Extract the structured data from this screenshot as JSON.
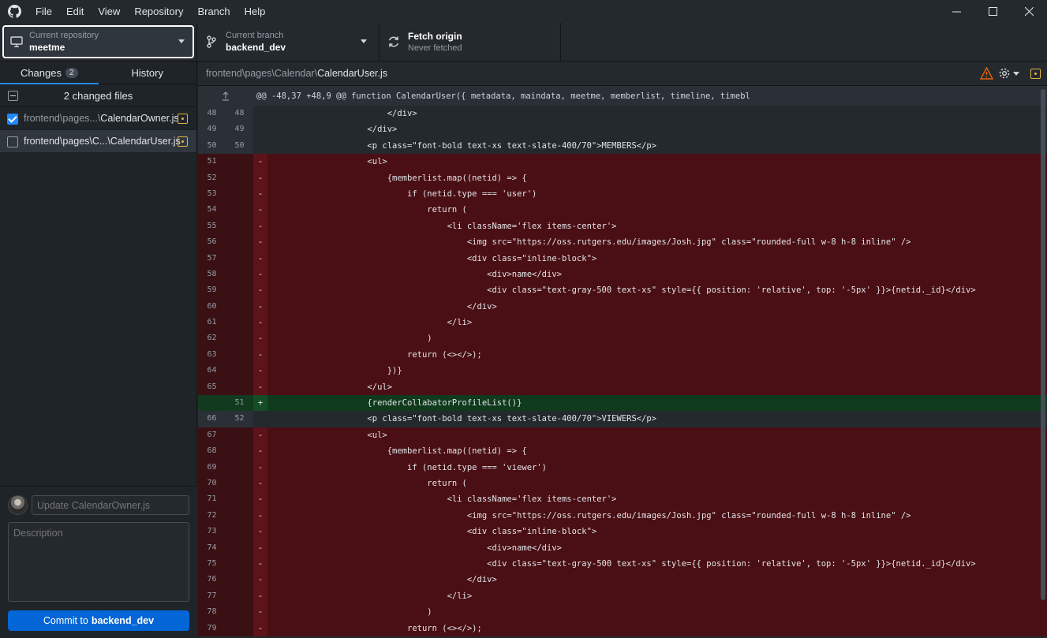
{
  "menu": [
    "File",
    "Edit",
    "View",
    "Repository",
    "Branch",
    "Help"
  ],
  "toolbar": {
    "repo_label": "Current repository",
    "repo_value": "meetme",
    "branch_label": "Current branch",
    "branch_value": "backend_dev",
    "fetch_label": "Fetch origin",
    "fetch_sub": "Never fetched"
  },
  "sidebar": {
    "tab_changes": "Changes",
    "tab_changes_count": "2",
    "tab_history": "History",
    "changed_files": "2 changed files",
    "files": [
      {
        "dim": "frontend\\pages...\\",
        "name": "CalendarOwner.js",
        "checked": true
      },
      {
        "dim": "frontend\\pages\\C...\\",
        "name": "CalendarUser.js",
        "checked": false
      }
    ],
    "summary_placeholder": "Update CalendarOwner.js",
    "description_placeholder": "Description",
    "commit_prefix": "Commit to",
    "commit_branch": "backend_dev"
  },
  "diff": {
    "path_prefix": "frontend\\pages\\Calendar\\",
    "path_file": "CalendarUser.js",
    "hunk": "@@ -48,37 +48,9 @@ function CalendarUser({ metadata, maindata, meetme, memberlist, timeline, timebl",
    "lines": [
      {
        "type": "ctx",
        "old": "48",
        "new": "48",
        "sign": "",
        "code": "                        </div>"
      },
      {
        "type": "ctx",
        "old": "49",
        "new": "49",
        "sign": "",
        "code": "                    </div>"
      },
      {
        "type": "ctx",
        "old": "50",
        "new": "50",
        "sign": "",
        "code": "                    <p class=\"font-bold text-xs text-slate-400/70\">MEMBERS</p>"
      },
      {
        "type": "del",
        "old": "51",
        "new": "",
        "sign": "-",
        "code": "                    <ul>"
      },
      {
        "type": "del",
        "old": "52",
        "new": "",
        "sign": "-",
        "code": "                        {memberlist.map((netid) => {"
      },
      {
        "type": "del",
        "old": "53",
        "new": "",
        "sign": "-",
        "code": "                            if (netid.type === 'user')"
      },
      {
        "type": "del",
        "old": "54",
        "new": "",
        "sign": "-",
        "code": "                                return ("
      },
      {
        "type": "del",
        "old": "55",
        "new": "",
        "sign": "-",
        "code": "                                    <li className='flex items-center'>"
      },
      {
        "type": "del",
        "old": "56",
        "new": "",
        "sign": "-",
        "code": "                                        <img src=\"https://oss.rutgers.edu/images/Josh.jpg\" class=\"rounded-full w-8 h-8 inline\" />"
      },
      {
        "type": "del",
        "old": "57",
        "new": "",
        "sign": "-",
        "code": "                                        <div class=\"inline-block\">"
      },
      {
        "type": "del",
        "old": "58",
        "new": "",
        "sign": "-",
        "code": "                                            <div>name</div>"
      },
      {
        "type": "del",
        "old": "59",
        "new": "",
        "sign": "-",
        "code": "                                            <div class=\"text-gray-500 text-xs\" style={{ position: 'relative', top: '-5px' }}>{netid._id}</div>"
      },
      {
        "type": "del",
        "old": "60",
        "new": "",
        "sign": "-",
        "code": "                                        </div>"
      },
      {
        "type": "del",
        "old": "61",
        "new": "",
        "sign": "-",
        "code": "                                    </li>"
      },
      {
        "type": "del",
        "old": "62",
        "new": "",
        "sign": "-",
        "code": "                                )"
      },
      {
        "type": "del",
        "old": "63",
        "new": "",
        "sign": "-",
        "code": "                            return (<></>);"
      },
      {
        "type": "del",
        "old": "64",
        "new": "",
        "sign": "-",
        "code": "                        })}"
      },
      {
        "type": "del",
        "old": "65",
        "new": "",
        "sign": "-",
        "code": "                    </ul>"
      },
      {
        "type": "add",
        "old": "",
        "new": "51",
        "sign": "+",
        "code": "                    {renderCollabatorProfileList()}"
      },
      {
        "type": "ctx",
        "old": "66",
        "new": "52",
        "sign": "",
        "code": "                    <p class=\"font-bold text-xs text-slate-400/70\">VIEWERS</p>"
      },
      {
        "type": "del",
        "old": "67",
        "new": "",
        "sign": "-",
        "code": "                    <ul>"
      },
      {
        "type": "del",
        "old": "68",
        "new": "",
        "sign": "-",
        "code": "                        {memberlist.map((netid) => {"
      },
      {
        "type": "del",
        "old": "69",
        "new": "",
        "sign": "-",
        "code": "                            if (netid.type === 'viewer')"
      },
      {
        "type": "del",
        "old": "70",
        "new": "",
        "sign": "-",
        "code": "                                return ("
      },
      {
        "type": "del",
        "old": "71",
        "new": "",
        "sign": "-",
        "code": "                                    <li className='flex items-center'>"
      },
      {
        "type": "del",
        "old": "72",
        "new": "",
        "sign": "-",
        "code": "                                        <img src=\"https://oss.rutgers.edu/images/Josh.jpg\" class=\"rounded-full w-8 h-8 inline\" />"
      },
      {
        "type": "del",
        "old": "73",
        "new": "",
        "sign": "-",
        "code": "                                        <div class=\"inline-block\">"
      },
      {
        "type": "del",
        "old": "74",
        "new": "",
        "sign": "-",
        "code": "                                            <div>name</div>"
      },
      {
        "type": "del",
        "old": "75",
        "new": "",
        "sign": "-",
        "code": "                                            <div class=\"text-gray-500 text-xs\" style={{ position: 'relative', top: '-5px' }}>{netid._id}</div>"
      },
      {
        "type": "del",
        "old": "76",
        "new": "",
        "sign": "-",
        "code": "                                        </div>"
      },
      {
        "type": "del",
        "old": "77",
        "new": "",
        "sign": "-",
        "code": "                                    </li>"
      },
      {
        "type": "del",
        "old": "78",
        "new": "",
        "sign": "-",
        "code": "                                )"
      },
      {
        "type": "del",
        "old": "79",
        "new": "",
        "sign": "-",
        "code": "                            return (<></>);"
      }
    ]
  },
  "colors": {
    "accent": "#2188ff",
    "deleted_bg": "#4a0f14",
    "added_bg": "#0f3a1c",
    "warning": "#e3b341"
  }
}
